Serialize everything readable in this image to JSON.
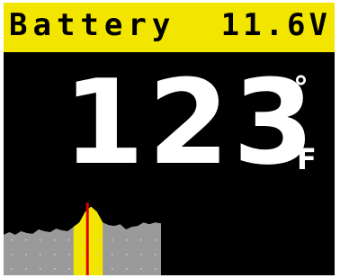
{
  "header": {
    "title": "Battery",
    "voltage": "11.6V"
  },
  "reading": {
    "temperature": "123",
    "degree_symbol": "°",
    "unit": "F"
  },
  "chart_data": {
    "type": "area",
    "description_values": [
      0.46,
      0.49,
      0.46,
      0.5,
      0.48,
      0.47,
      0.52,
      0.5,
      0.49,
      0.53,
      0.51,
      0.5,
      0.55,
      0.6,
      0.72,
      0.78,
      0.72,
      0.6,
      0.57,
      0.56,
      0.58,
      0.52,
      0.55,
      0.56,
      0.6,
      0.58,
      0.6,
      0.59
    ],
    "highlight_band": [
      12,
      17
    ],
    "current_index": 15
  },
  "colors": {
    "header_bg": "#f2e600",
    "screen_bg": "#000000",
    "text": "#ffffff",
    "chart_fill": "#9a9a9a",
    "highlight_fill": "#f2e600",
    "marker": "#e00000"
  },
  "icons": {
    "degree": "degree-icon"
  }
}
